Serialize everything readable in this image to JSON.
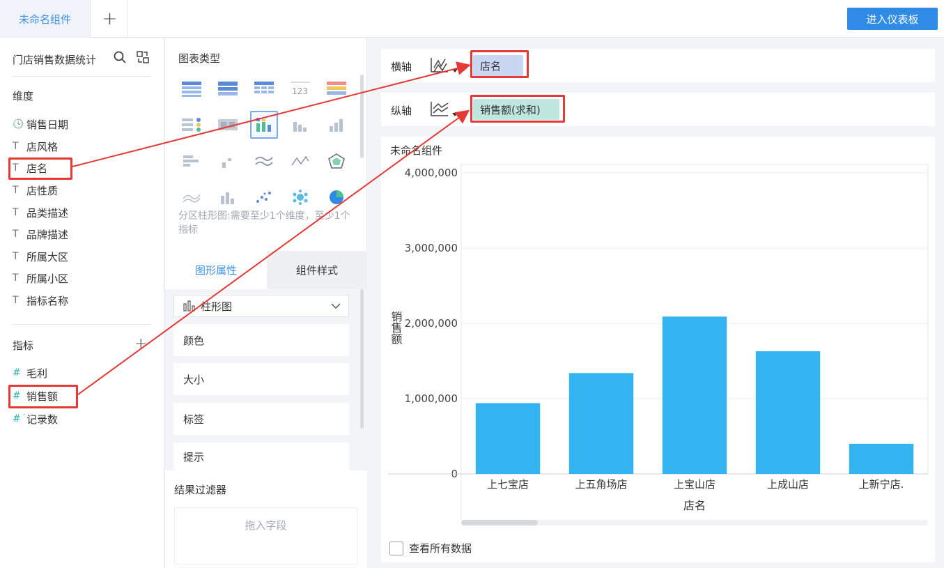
{
  "topbar": {
    "tab_label": "未命名组件",
    "add_tab": "+",
    "enter_button": "进入仪表板"
  },
  "left": {
    "dataset_title": "门店销售数据统计",
    "dimension_header": "维度",
    "dimensions": [
      {
        "icon": "clock-icon",
        "glyph": "🕓",
        "label": "销售日期"
      },
      {
        "icon": "text-type-icon",
        "glyph": "T",
        "label": "店风格"
      },
      {
        "icon": "text-type-icon",
        "glyph": "T",
        "label": "店名"
      },
      {
        "icon": "text-type-icon",
        "glyph": "T",
        "label": "店性质"
      },
      {
        "icon": "text-type-icon",
        "glyph": "T",
        "label": "品类描述"
      },
      {
        "icon": "text-type-icon",
        "glyph": "T",
        "label": "品牌描述"
      },
      {
        "icon": "text-type-icon",
        "glyph": "T",
        "label": "所属大区"
      },
      {
        "icon": "text-type-icon",
        "glyph": "T",
        "label": "所属小区"
      },
      {
        "icon": "text-type-icon",
        "glyph": "T",
        "label": "指标名称"
      }
    ],
    "measure_header": "指标",
    "measure_add": "+",
    "measures": [
      {
        "icon": "number-type-icon",
        "glyph": "#",
        "label": "毛利"
      },
      {
        "icon": "number-type-icon",
        "glyph": "#",
        "label": "销售额"
      },
      {
        "icon": "record-count-icon",
        "glyph": "#˙",
        "label": "记录数"
      }
    ]
  },
  "middle": {
    "chart_type_title": "图表类型",
    "chart_type_hint": "分区柱形图:需要至少1个维度，至少1个指标",
    "tab_graph": "图形属性",
    "tab_style": "组件样式",
    "chart_select": "柱形图",
    "props": [
      "颜色",
      "大小",
      "标签",
      "提示"
    ],
    "filter_title": "结果过滤器",
    "filter_placeholder": "拖入字段"
  },
  "axes": {
    "x_label": "横轴",
    "x_field": "店名",
    "y_label": "纵轴",
    "y_field": "销售额(求和)"
  },
  "chart": {
    "component_title": "未命名组件",
    "show_all_label": "查看所有数据",
    "bar_color": "#33b3f0"
  },
  "chart_data": {
    "type": "bar",
    "categories": [
      "上七宝店",
      "上五角场店",
      "上宝山店",
      "上成山店",
      "上新宁店."
    ],
    "values": [
      940000,
      1340000,
      2090000,
      1630000,
      400000
    ],
    "xlabel": "店名",
    "ylabel": "销售额",
    "ylim": [
      0,
      4000000
    ],
    "yticks": [
      "0",
      "1,000,000",
      "2,000,000",
      "3,000,000",
      "4,000,000"
    ],
    "grid": true
  }
}
